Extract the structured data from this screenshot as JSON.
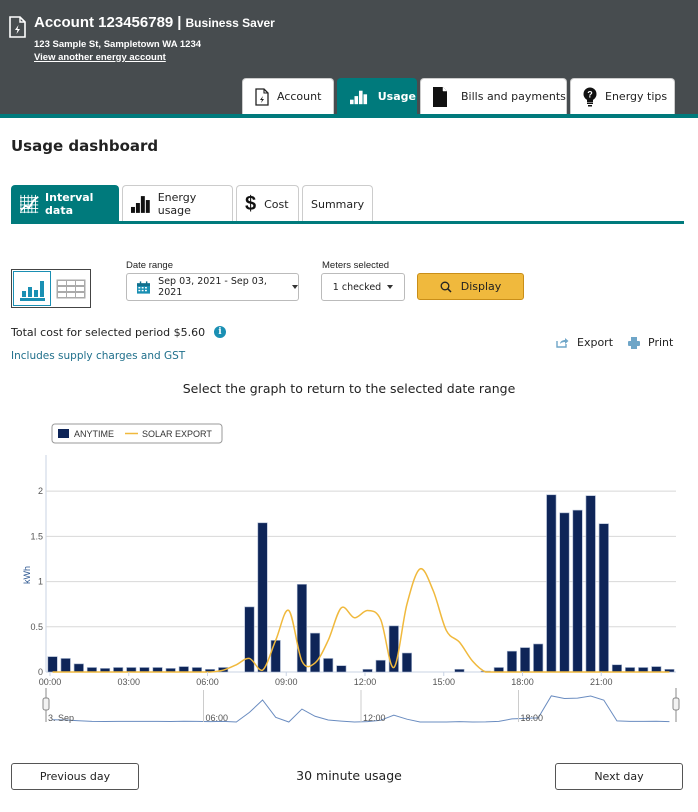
{
  "header": {
    "account_title": "Account 123456789",
    "separator": "|",
    "plan": "Business Saver",
    "address": "123 Sample St, Sampletown WA 1234",
    "view_another_link": "View another energy account",
    "icon": "document-bolt-icon"
  },
  "main_tabs": [
    {
      "label": "Account",
      "icon": "document-bolt-icon",
      "active": false
    },
    {
      "label": "Usage",
      "icon": "bar-chart-icon",
      "active": true
    },
    {
      "label": "Bills and payments",
      "icon": "document-icon",
      "active": false
    },
    {
      "label": "Energy tips",
      "icon": "lightbulb-icon",
      "active": false
    }
  ],
  "page_title": "Usage dashboard",
  "sub_tabs": [
    {
      "label": "Interval data",
      "icon": "grid-chart-icon",
      "active": true
    },
    {
      "label": "Energy usage",
      "icon": "bar-chart-icon",
      "active": false
    },
    {
      "label": "Cost",
      "icon": "dollar-icon",
      "active": false
    },
    {
      "label": "Summary",
      "icon": "",
      "active": false
    }
  ],
  "filters": {
    "view_modes": [
      "chart-view",
      "table-view"
    ],
    "active_view": "chart-view",
    "date_range_label": "Date range",
    "date_range_value": "Sep 03, 2021 - Sep 03, 2021",
    "meters_label": "Meters selected",
    "meters_value": "1 checked",
    "display_button": "Display"
  },
  "summary": {
    "total_cost_text": "Total cost for selected period $5.60",
    "info_glyph": "i",
    "supply_note": "Includes supply charges and GST"
  },
  "actions": {
    "export": "Export",
    "print": "Print"
  },
  "graph_hint": "Select the graph to return to the selected date range",
  "colors": {
    "teal": "#007a7c",
    "header_bg": "#474c4f",
    "anytime_bar": "#0e2558",
    "solar_line": "#f0b93d",
    "display_button": "#f0b93d",
    "link_blue": "#1f6f8b"
  },
  "chart_data": {
    "type": "bar",
    "title": "",
    "xlabel": "",
    "ylabel": "kWh",
    "ylim": [
      0,
      2.4
    ],
    "yticks": [
      0,
      0.5,
      1,
      1.5,
      2
    ],
    "ytick_labels": [
      "0",
      "0.5",
      "1",
      "1.5",
      "2"
    ],
    "xtick_labels": [
      "00:00",
      "03:00",
      "06:00",
      "09:00",
      "12:00",
      "15:00",
      "18:00",
      "21:00"
    ],
    "grid": true,
    "legend_position": "top-left",
    "interval_minutes": 30,
    "series": [
      {
        "name": "ANYTIME",
        "type": "bar",
        "values": [
          0.17,
          0.15,
          0.09,
          0.05,
          0.04,
          0.05,
          0.05,
          0.05,
          0.05,
          0.04,
          0.06,
          0.05,
          0.03,
          0.05,
          0.0,
          0.72,
          1.65,
          0.35,
          0.0,
          0.97,
          0.43,
          0.15,
          0.07,
          0.0,
          0.03,
          0.13,
          0.51,
          0.21,
          0.0,
          0.0,
          0.0,
          0.03,
          0.0,
          0.01,
          0.05,
          0.23,
          0.27,
          0.31,
          1.96,
          1.76,
          1.79,
          1.95,
          1.64,
          0.08,
          0.05,
          0.05,
          0.06,
          0.03
        ]
      },
      {
        "name": "SOLAR EXPORT",
        "type": "line",
        "values": [
          0,
          0,
          0,
          0,
          0,
          0,
          0,
          0,
          0,
          0,
          0,
          0,
          0,
          0.02,
          0.08,
          0.15,
          0.02,
          0.35,
          0.68,
          0.12,
          0.1,
          0.35,
          0.71,
          0.6,
          0.68,
          0.58,
          0.05,
          0.75,
          1.14,
          0.9,
          0.46,
          0.33,
          0.12,
          0.0,
          0,
          0,
          0,
          0,
          0,
          0,
          0,
          0,
          0,
          0,
          0,
          0,
          0,
          0
        ]
      }
    ],
    "navigator": {
      "labels": [
        "3. Sep",
        "06:00",
        "12:00",
        "18:00"
      ]
    }
  },
  "footer": {
    "previous_day": "Previous day",
    "interval_label": "30 minute usage",
    "next_day": "Next day"
  }
}
